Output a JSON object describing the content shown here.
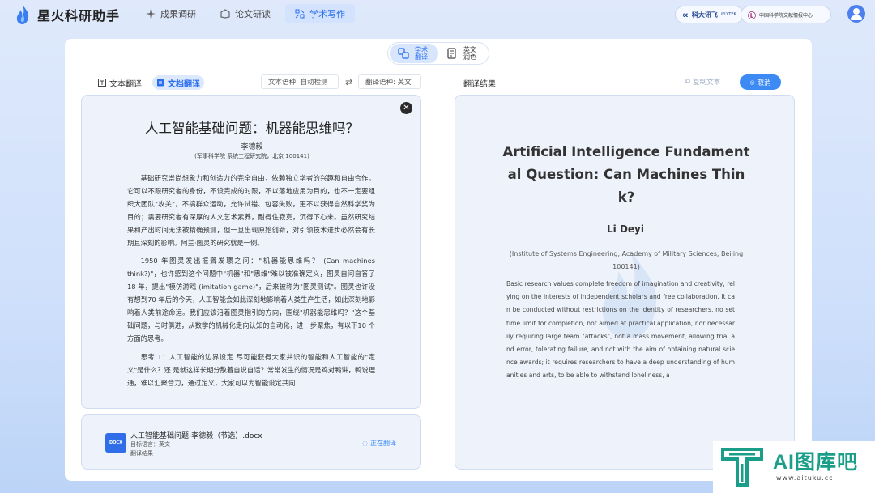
{
  "app": {
    "name": "星火科研助手"
  },
  "nav": [
    {
      "label": "成果调研",
      "icon": "sparkle-icon"
    },
    {
      "label": "论文研读",
      "icon": "book-icon"
    },
    {
      "label": "学术写作",
      "icon": "pen-grid-icon"
    }
  ],
  "partners": [
    {
      "label": "科大讯飞",
      "sub": "iFLYTEK"
    },
    {
      "label": "中国科学院文献情报中心"
    }
  ],
  "mode": [
    {
      "label": "学术\n翻译",
      "icon": "translate-icon"
    },
    {
      "label": "英文\n润色",
      "icon": "polish-icon"
    }
  ],
  "tabs": {
    "text": "文本翻译",
    "doc": "文档翻译"
  },
  "lang": {
    "source": "文本语种: 自动检测",
    "target": "翻译语种: 英文"
  },
  "result": {
    "title": "翻译结果",
    "copy": "复制文本",
    "cancel": "取消"
  },
  "source_doc": {
    "title": "人工智能基础问题：机器能思维吗？",
    "author": "李德毅",
    "affiliation": "(军事科学院 系统工程研究院，北京 100141)",
    "paragraphs": [
      "基础研究崇尚想象力和创造力的完全自由，依赖独立学者的兴趣和自由合作。它可以不限研究者的身份，不设完成的时限，不以落地应用为目的，也不一定要组织大团队\"攻关\"，不搞群众运动，允许试错、包容失败，更不以获得自然科学奖为目的；需要研究者有深厚的人文艺术素养，耐得住寂寞，沉得下心来。虽然研究结果和产出时间无法被精确预测，但一旦出现原始创新，对引领技术进步必然会有长期且深刻的影响。阿兰·图灵的研究就是一例。",
      "1950 年图灵发出振聋发聩之问：\"机器能思维吗？ (Can machines think?)\"，也许感到这个问题中\"机器\"和\"思维\"难以被准确定义，图灵自问自答了 18 年，提出\"模仿游戏 (imitation game)\"，后来被称为\"图灵测试\"。图灵也许没有想到70 年后的今天，人工智能会如此深刻地影响着人类生产生活，如此深刻地影响着人类前途命运。我们应该沿着图灵指引的方向，围绕\"机器能思维吗？\"这个基础问题，与时俱进，从数学的机械化走向认知的自动化，进一步聚焦，有以下10 个方面的思考。",
      "思考 1：人工智能的边界设定 尽可能获得大家共识的智能和人工智能的\"定义\"是什么？还 是就这样长期分散着自说自话？常常发生的情况是鸡对鸭讲，鸭说理通，难以汇聚合力，通过定义，大家可以为智能设定共同"
    ]
  },
  "file": {
    "name": "人工智能基础问题-李德毅（节选）.docx",
    "badge": "DOCX",
    "target_lang": "目标语言：英文",
    "result_label": "翻译结果",
    "status": "正在翻译"
  },
  "translation": {
    "title": "Artificial Intelligence Fundamental Question: Can Machines Think?",
    "author": "Li Deyi",
    "affiliation": "(Institute of Systems Engineering, Academy of Military Sciences, Beijing 100141)",
    "body": "Basic research values complete freedom of imagination and creativity, relying on the interests of independent scholars and free collaboration. It can be conducted without restrictions on the identity of researchers, no set time limit for completion, not aimed at practical application, nor necessarily requiring large team \"attacks\", not a mass movement, allowing trial and error, tolerating failure, and not with the aim of obtaining natural science awards; it requires researchers to have a deep understanding of humanities and arts, to be able to withstand loneliness, a"
  },
  "brand": {
    "name": "AI图库吧",
    "url": "www.aituku.cc"
  },
  "colors": {
    "accent": "#3d8af5",
    "brand": "#1a9e8a",
    "panel": "#eef3fb"
  }
}
